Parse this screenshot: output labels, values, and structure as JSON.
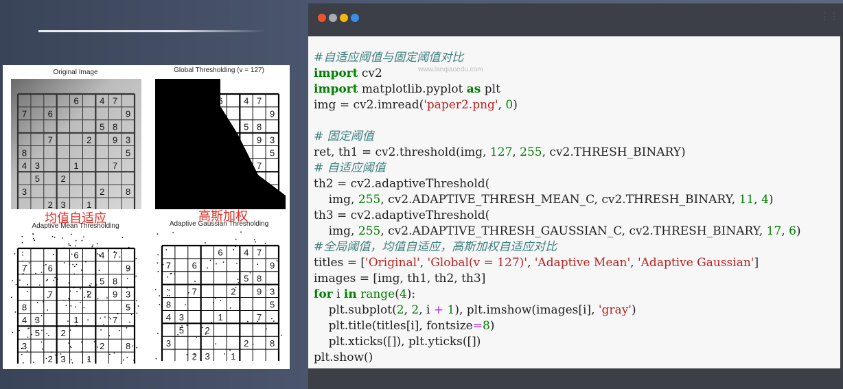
{
  "figure": {
    "titles": {
      "original": "Original Image",
      "global": "Global Thresholding (v = 127)",
      "mean": "Adaptive Mean Thresholding",
      "gaussian": "Adaptive Gaussian Thresholding"
    },
    "overlay_labels": {
      "mean": "均值自适应",
      "gaussian": "高斯加权"
    },
    "sudoku_digits": [
      {
        "r": 0,
        "c": 4,
        "v": "6"
      },
      {
        "r": 0,
        "c": 6,
        "v": "4"
      },
      {
        "r": 0,
        "c": 7,
        "v": "7"
      },
      {
        "r": 1,
        "c": 0,
        "v": "7"
      },
      {
        "r": 1,
        "c": 2,
        "v": "6"
      },
      {
        "r": 1,
        "c": 8,
        "v": "9"
      },
      {
        "r": 2,
        "c": 6,
        "v": "5"
      },
      {
        "r": 2,
        "c": 7,
        "v": "8"
      },
      {
        "r": 3,
        "c": 2,
        "v": "7"
      },
      {
        "r": 3,
        "c": 5,
        "v": "2"
      },
      {
        "r": 3,
        "c": 7,
        "v": "9"
      },
      {
        "r": 3,
        "c": 8,
        "v": "3"
      },
      {
        "r": 4,
        "c": 0,
        "v": "8"
      },
      {
        "r": 4,
        "c": 8,
        "v": "5"
      },
      {
        "r": 5,
        "c": 0,
        "v": "4"
      },
      {
        "r": 5,
        "c": 1,
        "v": "3"
      },
      {
        "r": 5,
        "c": 4,
        "v": "1"
      },
      {
        "r": 5,
        "c": 7,
        "v": "7"
      },
      {
        "r": 6,
        "c": 1,
        "v": "5"
      },
      {
        "r": 6,
        "c": 3,
        "v": "2"
      },
      {
        "r": 7,
        "c": 0,
        "v": "3"
      },
      {
        "r": 7,
        "c": 6,
        "v": "2"
      },
      {
        "r": 7,
        "c": 8,
        "v": "8"
      },
      {
        "r": 8,
        "c": 2,
        "v": "2"
      },
      {
        "r": 8,
        "c": 3,
        "v": "3"
      },
      {
        "r": 8,
        "c": 5,
        "v": "1"
      }
    ]
  },
  "editor": {
    "watermark": "www.lanqiaoedu.com",
    "dot_colors": [
      "#f0522d",
      "#a9abb2",
      "#f5b70d",
      "#3b8fe9"
    ],
    "lines": [
      [
        [
          "c",
          "#自适应阈值与固定阈值对比"
        ]
      ],
      [
        [
          "k",
          "import"
        ],
        [
          "t",
          " cv2"
        ]
      ],
      [
        [
          "k",
          "import"
        ],
        [
          "t",
          " matplotlib.pyplot "
        ],
        [
          "k",
          "as"
        ],
        [
          "t",
          " plt"
        ]
      ],
      [
        [
          "t",
          "img = cv2.imread("
        ],
        [
          "s",
          "'paper2.png'"
        ],
        [
          "t",
          ", "
        ],
        [
          "n",
          "0"
        ],
        [
          "t",
          ")"
        ]
      ],
      [
        [
          "t",
          ""
        ]
      ],
      [
        [
          "c",
          "# 固定阈值"
        ]
      ],
      [
        [
          "t",
          "ret, th1 = cv2.threshold(img, "
        ],
        [
          "n",
          "127"
        ],
        [
          "t",
          ", "
        ],
        [
          "n",
          "255"
        ],
        [
          "t",
          ", cv2.THRESH_BINARY)"
        ]
      ],
      [
        [
          "c",
          "# 自适应阈值"
        ]
      ],
      [
        [
          "t",
          "th2 = cv2.adaptiveThreshold("
        ]
      ],
      [
        [
          "t",
          "    img, "
        ],
        [
          "n",
          "255"
        ],
        [
          "t",
          ", cv2.ADAPTIVE_THRESH_MEAN_C, cv2.THRESH_BINARY, "
        ],
        [
          "n",
          "11"
        ],
        [
          "t",
          ", "
        ],
        [
          "n",
          "4"
        ],
        [
          "t",
          ")"
        ]
      ],
      [
        [
          "t",
          "th3 = cv2.adaptiveThreshold("
        ]
      ],
      [
        [
          "t",
          "    img, "
        ],
        [
          "n",
          "255"
        ],
        [
          "t",
          ", cv2.ADAPTIVE_THRESH_GAUSSIAN_C, cv2.THRESH_BINARY, "
        ],
        [
          "n",
          "17"
        ],
        [
          "t",
          ", "
        ],
        [
          "n",
          "6"
        ],
        [
          "t",
          ")"
        ]
      ],
      [
        [
          "c",
          "#全局阈值，均值自适应，高斯加权自适应对比"
        ]
      ],
      [
        [
          "t",
          "titles = ["
        ],
        [
          "s",
          "'Original'"
        ],
        [
          "t",
          ", "
        ],
        [
          "s",
          "'Global(v = 127)'"
        ],
        [
          "t",
          ", "
        ],
        [
          "s",
          "'Adaptive Mean'"
        ],
        [
          "t",
          ", "
        ],
        [
          "s",
          "'Adaptive Gaussian'"
        ],
        [
          "t",
          "]"
        ]
      ],
      [
        [
          "t",
          "images = [img, th1, th2, th3]"
        ]
      ],
      [
        [
          "k",
          "for"
        ],
        [
          "t",
          " i "
        ],
        [
          "k",
          "in"
        ],
        [
          "t",
          " "
        ],
        [
          "b",
          "range"
        ],
        [
          "t",
          "("
        ],
        [
          "n",
          "4"
        ],
        [
          "t",
          "):"
        ]
      ],
      [
        [
          "t",
          "    plt.subplot("
        ],
        [
          "n",
          "2"
        ],
        [
          "t",
          ", "
        ],
        [
          "n",
          "2"
        ],
        [
          "t",
          ", i "
        ],
        [
          "o",
          "+"
        ],
        [
          "t",
          " "
        ],
        [
          "n",
          "1"
        ],
        [
          "t",
          "), plt.imshow(images[i], "
        ],
        [
          "s",
          "'gray'"
        ],
        [
          "t",
          ")"
        ]
      ],
      [
        [
          "t",
          "    plt.title(titles[i], fontsize"
        ],
        [
          "o",
          "="
        ],
        [
          "n",
          "8"
        ],
        [
          "t",
          ")"
        ]
      ],
      [
        [
          "t",
          "    plt.xticks([]), plt.yticks([])"
        ]
      ],
      [
        [
          "t",
          "plt.show()"
        ]
      ]
    ]
  }
}
